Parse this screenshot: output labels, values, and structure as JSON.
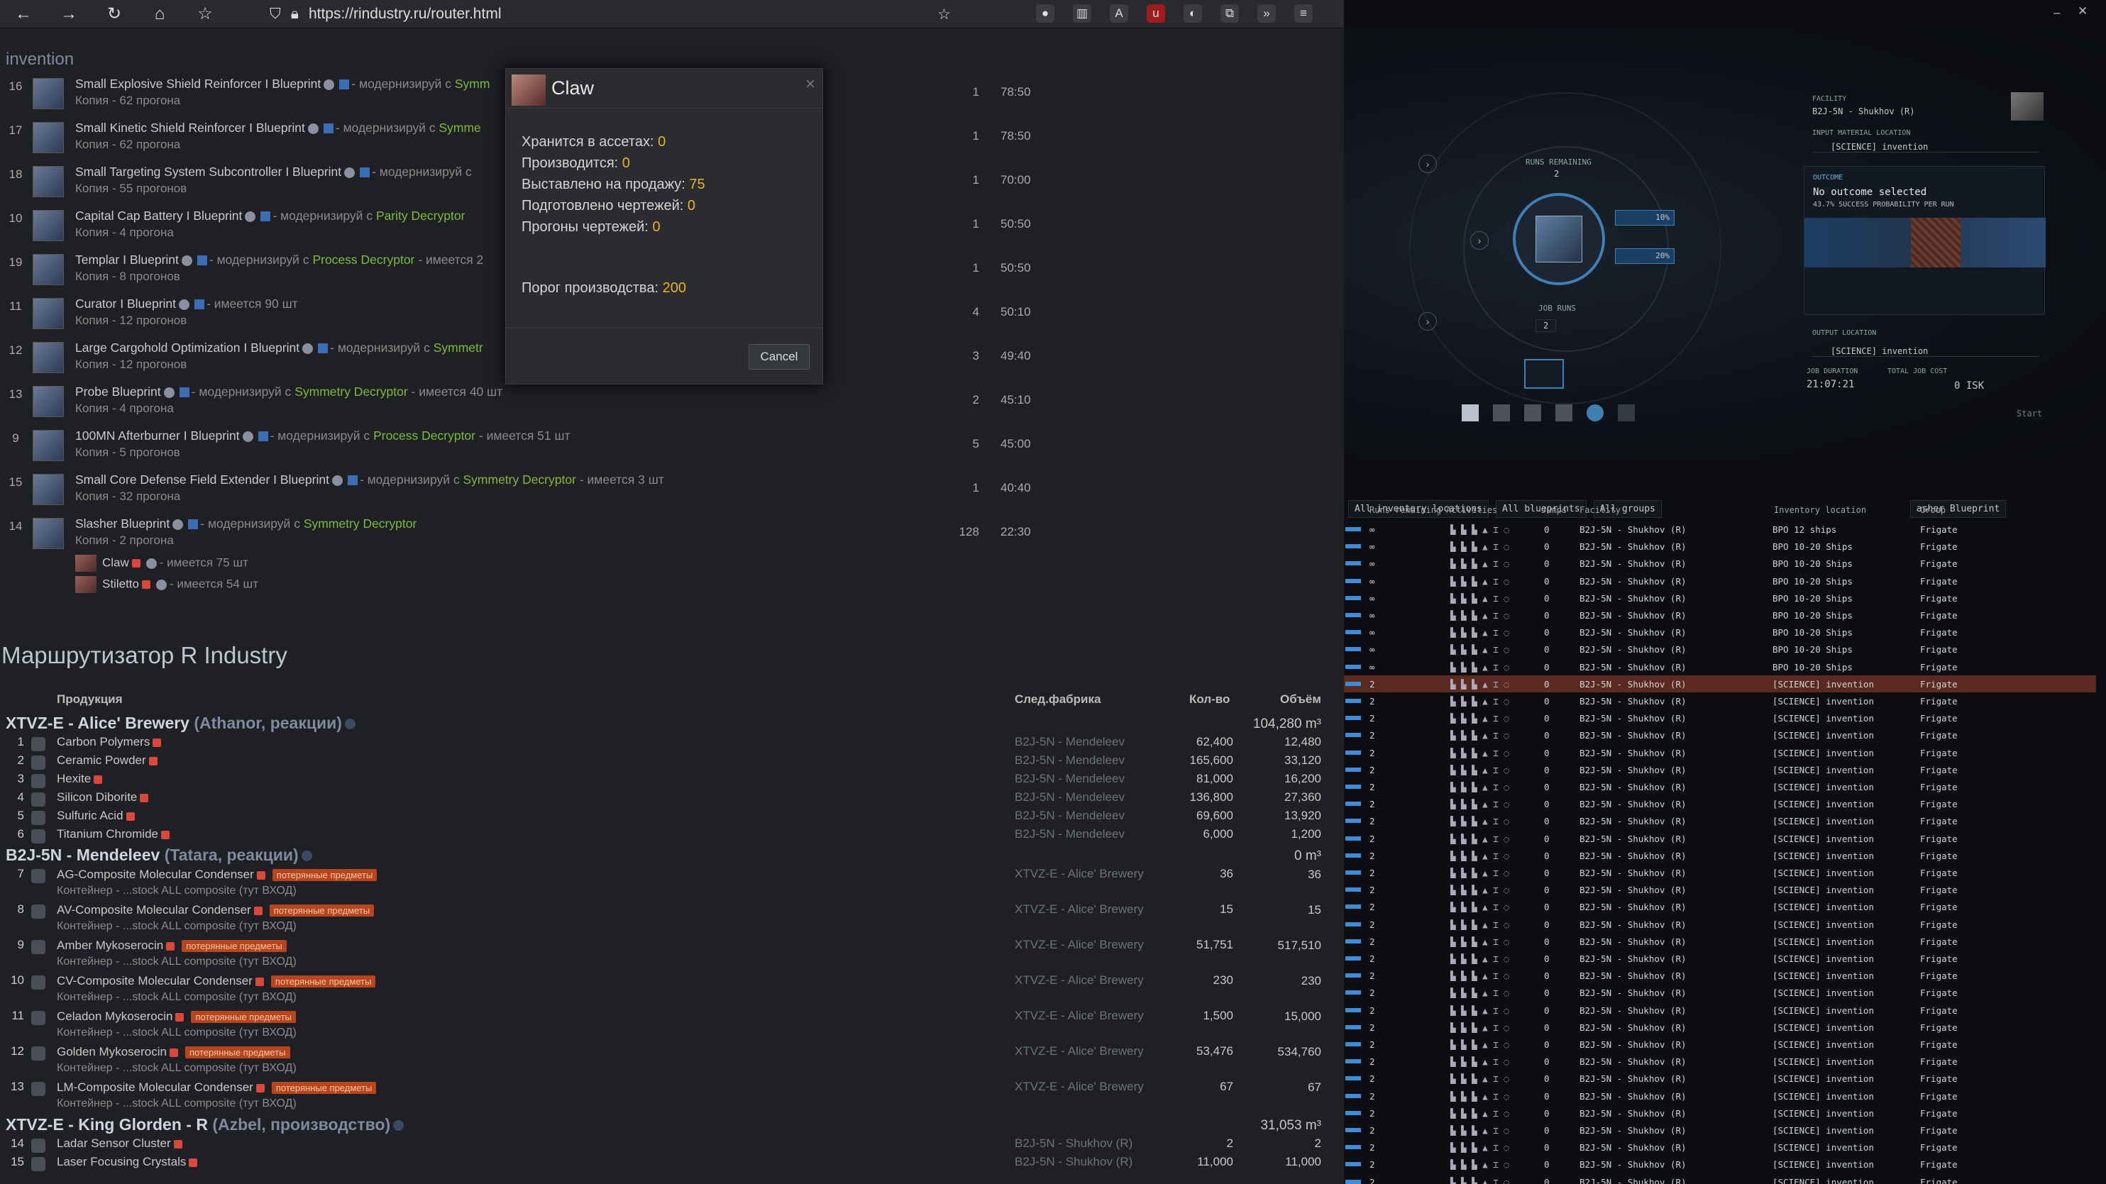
{
  "browser": {
    "url": "https://rindustry.ru/router.html"
  },
  "invention": {
    "title": "invention",
    "rows": [
      {
        "num": "16",
        "name": "Small Explosive Shield Reinforcer I Blueprint",
        "mod": "- модернизируй с",
        "dec": "Symm",
        "copy": "Копия - 62 прогона",
        "qty": "1",
        "time": "78:50"
      },
      {
        "num": "17",
        "name": "Small Kinetic Shield Reinforcer I Blueprint",
        "mod": "- модернизируй с",
        "dec": "Symme",
        "copy": "Копия - 62 прогона",
        "qty": "1",
        "time": "78:50"
      },
      {
        "num": "18",
        "name": "Small Targeting System Subcontroller I Blueprint",
        "mod": "- модернизируй с",
        "dec": "",
        "copy": "Копия - 55 прогонов",
        "qty": "1",
        "time": "70:00"
      },
      {
        "num": "10",
        "name": "Capital Cap Battery I Blueprint",
        "mod": "- модернизируй с",
        "dec": "Parity Decryptor",
        "copy": "Копия - 4 прогона",
        "qty": "1",
        "time": "50:50"
      },
      {
        "num": "19",
        "name": "Templar I Blueprint",
        "mod": "- модернизируй с",
        "dec": "Process Decryptor",
        "extra": "- имеется 2",
        "copy": "Копия - 8 прогонов",
        "qty": "1",
        "time": "50:50"
      },
      {
        "num": "11",
        "name": "Curator I Blueprint",
        "mod": "",
        "dec": "",
        "extra": "- имеется 90 шт",
        "copy": "Копия - 12 прогонов",
        "qty": "4",
        "time": "50:10"
      },
      {
        "num": "12",
        "name": "Large Cargohold Optimization I Blueprint",
        "mod": "- модернизируй с",
        "dec": "Symmetr",
        "copy": "Копия - 12 прогонов",
        "qty": "3",
        "time": "49:40"
      },
      {
        "num": "13",
        "name": "Probe Blueprint",
        "mod": "- модернизируй с",
        "dec": "Symmetry Decryptor",
        "extra": "- имеется 40 шт",
        "copy": "Копия - 4 прогона",
        "qty": "2",
        "time": "45:10"
      },
      {
        "num": "9",
        "name": "100MN Afterburner I Blueprint",
        "mod": "- модернизируй с",
        "dec": "Process Decryptor",
        "extra": "- имеется 51 шт",
        "copy": "Копия - 5 прогонов",
        "qty": "5",
        "time": "45:00"
      },
      {
        "num": "15",
        "name": "Small Core Defense Field Extender I Blueprint",
        "mod": "- модернизируй с",
        "dec": "Symmetry Decryptor",
        "extra": "- имеется 3 шт",
        "copy": "Копия - 32 прогона",
        "qty": "1",
        "time": "40:40"
      },
      {
        "num": "14",
        "name": "Slasher Blueprint",
        "mod": "- модернизируй с",
        "dec": "Symmetry Decryptor",
        "copy": "Копия - 2 прогона",
        "qty": "128",
        "time": "22:30"
      }
    ],
    "sub": [
      {
        "name": "Claw",
        "extra": "- имеется 75 шт"
      },
      {
        "name": "Stiletto",
        "extra": "- имеется 54 шт"
      }
    ]
  },
  "modal": {
    "title": "Claw",
    "lines": [
      {
        "label": "Хранится в ассетах:",
        "value": "0"
      },
      {
        "label": "Производится:",
        "value": "0"
      },
      {
        "label": "Выставлено на продажу:",
        "value": "75"
      },
      {
        "label": "Подготовлено чертежей:",
        "value": "0"
      },
      {
        "label": "Прогоны чертежей:",
        "value": "0"
      }
    ],
    "threshold_label": "Порог производства:",
    "threshold_value": "200",
    "cancel": "Cancel"
  },
  "router": {
    "title": "Маршрутизатор R Industry",
    "cols": {
      "product": "Продукция",
      "next": "След.фабрика",
      "qty": "Кол-во",
      "vol": "Объём"
    },
    "groups": [
      {
        "name": "XTVZ-E - Alice' Brewery",
        "sub": "(Athanor, реакции)",
        "vol": "104,280 m³",
        "rows": [
          {
            "n": "1",
            "name": "Carbon Polymers",
            "fac": "B2J-5N - Mendeleev",
            "qty": "62,400",
            "vol": "12,480"
          },
          {
            "n": "2",
            "name": "Ceramic Powder",
            "fac": "B2J-5N - Mendeleev",
            "qty": "165,600",
            "vol": "33,120"
          },
          {
            "n": "3",
            "name": "Hexite",
            "fac": "B2J-5N - Mendeleev",
            "qty": "81,000",
            "vol": "16,200"
          },
          {
            "n": "4",
            "name": "Silicon Diborite",
            "fac": "B2J-5N - Mendeleev",
            "qty": "136,800",
            "vol": "27,360"
          },
          {
            "n": "5",
            "name": "Sulfuric Acid",
            "fac": "B2J-5N - Mendeleev",
            "qty": "69,600",
            "vol": "13,920"
          },
          {
            "n": "6",
            "name": "Titanium Chromide",
            "fac": "B2J-5N - Mendeleev",
            "qty": "6,000",
            "vol": "1,200"
          }
        ]
      },
      {
        "name": "B2J-5N - Mendeleev",
        "sub": "(Tatara, реакции)",
        "vol": "0 m³",
        "rows": [
          {
            "n": "7",
            "name": "AG-Composite Molecular Condenser",
            "fac": "XTVZ-E - Alice' Brewery",
            "qty": "36",
            "vol": "36"
          },
          {
            "n": "8",
            "name": "AV-Composite Molecular Condenser",
            "fac": "XTVZ-E - Alice' Brewery",
            "qty": "15",
            "vol": "15"
          },
          {
            "n": "9",
            "name": "Amber Mykoserocin",
            "fac": "XTVZ-E - Alice' Brewery",
            "qty": "51,751",
            "vol": "517,510"
          },
          {
            "n": "10",
            "name": "CV-Composite Molecular Condenser",
            "fac": "XTVZ-E - Alice' Brewery",
            "qty": "230",
            "vol": "230"
          },
          {
            "n": "11",
            "name": "Celadon Mykoserocin",
            "fac": "XTVZ-E - Alice' Brewery",
            "qty": "1,500",
            "vol": "15,000"
          },
          {
            "n": "12",
            "name": "Golden Mykoserocin",
            "fac": "XTVZ-E - Alice' Brewery",
            "qty": "53,476",
            "vol": "534,760"
          },
          {
            "n": "13",
            "name": "LM-Composite Molecular Condenser",
            "fac": "XTVZ-E - Alice' Brewery",
            "qty": "67",
            "vol": "67"
          }
        ],
        "lost": "потерянные предметы",
        "container": "Контейнер - ...stock ALL composite (тут ВХОД)"
      },
      {
        "name": "XTVZ-E - King Glorden - R",
        "sub": "(Azbel, производство)",
        "vol": "31,053 m³",
        "rows": [
          {
            "n": "14",
            "name": "Ladar Sensor Cluster",
            "fac": "B2J-5N - Shukhov (R)",
            "qty": "2",
            "vol": "2"
          },
          {
            "n": "15",
            "name": "Laser Focusing Crystals",
            "fac": "B2J-5N - Shukhov (R)",
            "qty": "11,000",
            "vol": "11,000"
          }
        ]
      }
    ]
  },
  "game": {
    "facility_label": "FACILITY",
    "facility": "B2J-5N - Shukhov (R)",
    "input_label": "INPUT MATERIAL LOCATION",
    "input": "[SCIENCE] invention",
    "outcome_label": "OUTCOME",
    "outcome": "No outcome selected",
    "prob": "43.7% SUCCESS PROBABILITY PER RUN",
    "output_label": "OUTPUT LOCATION",
    "output": "[SCIENCE] invention",
    "duration_label": "JOB DURATION",
    "duration": "21:07:21",
    "cost_label": "TOTAL JOB COST",
    "cost": "0 ISK",
    "runs_label": "RUNS REMAINING",
    "runs": "2",
    "jobruns_label": "JOB RUNS",
    "jobruns": "2",
    "pct1": "10%",
    "pct2": "20%",
    "start": "Start",
    "filters": [
      "All inventory locations",
      "All blueprints",
      "All groups"
    ],
    "search": "asher Blueprint",
    "cols": [
      "Runs remaining",
      "Activities",
      "Jumps",
      "Facility",
      "Inventory location",
      "Group"
    ],
    "facility_val": "B2J-5N - Shukhov (R)",
    "group_val": "Frigate",
    "jumps_val": "0",
    "bpo12": "BPO 12 ships",
    "bpo1020": "BPO 10-20 Ships",
    "sci": "[SCIENCE] invention",
    "inf": "∞",
    "two": "2"
  }
}
